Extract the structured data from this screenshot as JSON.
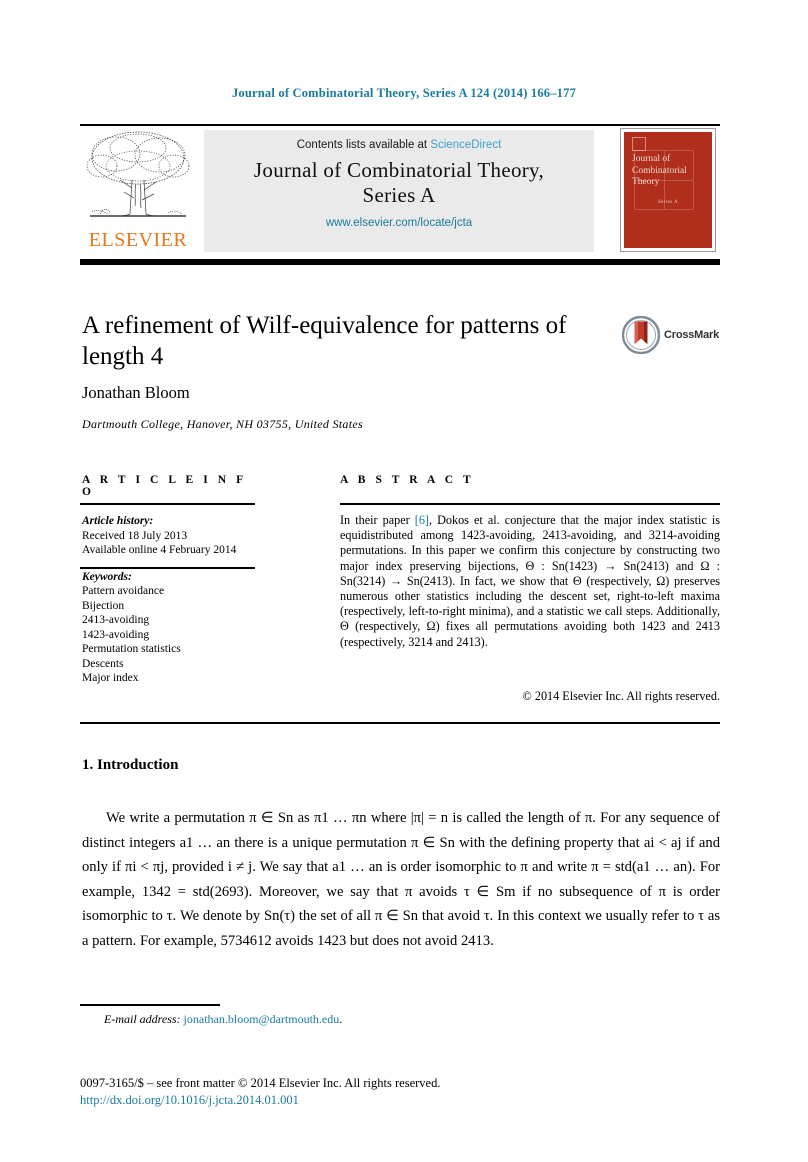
{
  "running_head": "Journal of Combinatorial Theory, Series A 124 (2014) 166–177",
  "masthead": {
    "publisher_name": "ELSEVIER",
    "publisher_logo_icon": "elsevier-tree-icon",
    "contents_prefix": "Contents lists available at ",
    "sciencedirect_link": "ScienceDirect",
    "journal_title_line1": "Journal of Combinatorial Theory,",
    "journal_title_line2": "Series A",
    "journal_url": "www.elsevier.com/locate/jcta",
    "cover": {
      "title": "Journal of Combinatorial Theory",
      "subtitle": "Series A",
      "color": "#b02e1c"
    }
  },
  "article": {
    "title": "A refinement of Wilf-equivalence for patterns of length 4",
    "author": "Jonathan Bloom",
    "affiliation": "Dartmouth College, Hanover, NH 03755, United States",
    "crossmark_label": "CrossMark",
    "crossmark_icon": "crossmark-badge-icon"
  },
  "info": {
    "heading": "A R T I C L E    I N F O",
    "history_label": "Article history:",
    "history": [
      "Received 18 July 2013",
      "Available online 4 February 2014"
    ],
    "keywords_label": "Keywords:",
    "keywords": [
      "Pattern avoidance",
      "Bijection",
      "2413-avoiding",
      "1423-avoiding",
      "Permutation statistics",
      "Descents",
      "Major index"
    ]
  },
  "abstract": {
    "heading": "A B S T R A C T",
    "text_before_ref": "In their paper ",
    "ref": "[6]",
    "text_after_ref": ", Dokos et al. conjecture that the major index statistic is equidistributed among 1423-avoiding, 2413-avoiding, and 3214-avoiding permutations. In this paper we confirm this conjecture by constructing two major index preserving bijections, Θ : Sn(1423) → Sn(2413) and Ω : Sn(3214) → Sn(2413). In fact, we show that Θ (respectively, Ω) preserves numerous other statistics including the descent set, right-to-left maxima (respectively, left-to-right minima), and a statistic we call steps. Additionally, Θ (respectively, Ω) fixes all permutations avoiding both 1423 and 2413 (respectively, 3214 and 2413).",
    "copyright": "© 2014 Elsevier Inc. All rights reserved."
  },
  "body": {
    "section_number_title": "1.  Introduction",
    "paragraph": "We write a permutation π ∈ Sn as π1 … πn where |π| = n is called the length of π. For any sequence of distinct integers a1 … an there is a unique permutation π ∈ Sn with the defining property that ai < aj if and only if πi < πj, provided i ≠ j. We say that a1 … an is order isomorphic to π and write π = std(a1 … an). For example, 1342 = std(2693). Moreover, we say that π avoids τ ∈ Sm if no subsequence of π is order isomorphic to τ. We denote by Sn(τ) the set of all π ∈ Sn that avoid τ. In this context we usually refer to τ as a pattern. For example, 5734612 avoids 1423 but does not avoid 2413."
  },
  "footer": {
    "email_label": "E-mail address: ",
    "email": "jonathan.bloom@dartmouth.edu",
    "email_suffix": ".",
    "issn_line": "0097-3165/$ – see front matter  © 2014 Elsevier Inc. All rights reserved.",
    "doi_line": "http://dx.doi.org/10.1016/j.jcta.2014.01.001"
  },
  "colors": {
    "link_teal": "#1a7b9e",
    "sciencedirect_blue": "#3aa3d0",
    "elsevier_orange": "#e8761a",
    "cover_red": "#b02e1c"
  }
}
